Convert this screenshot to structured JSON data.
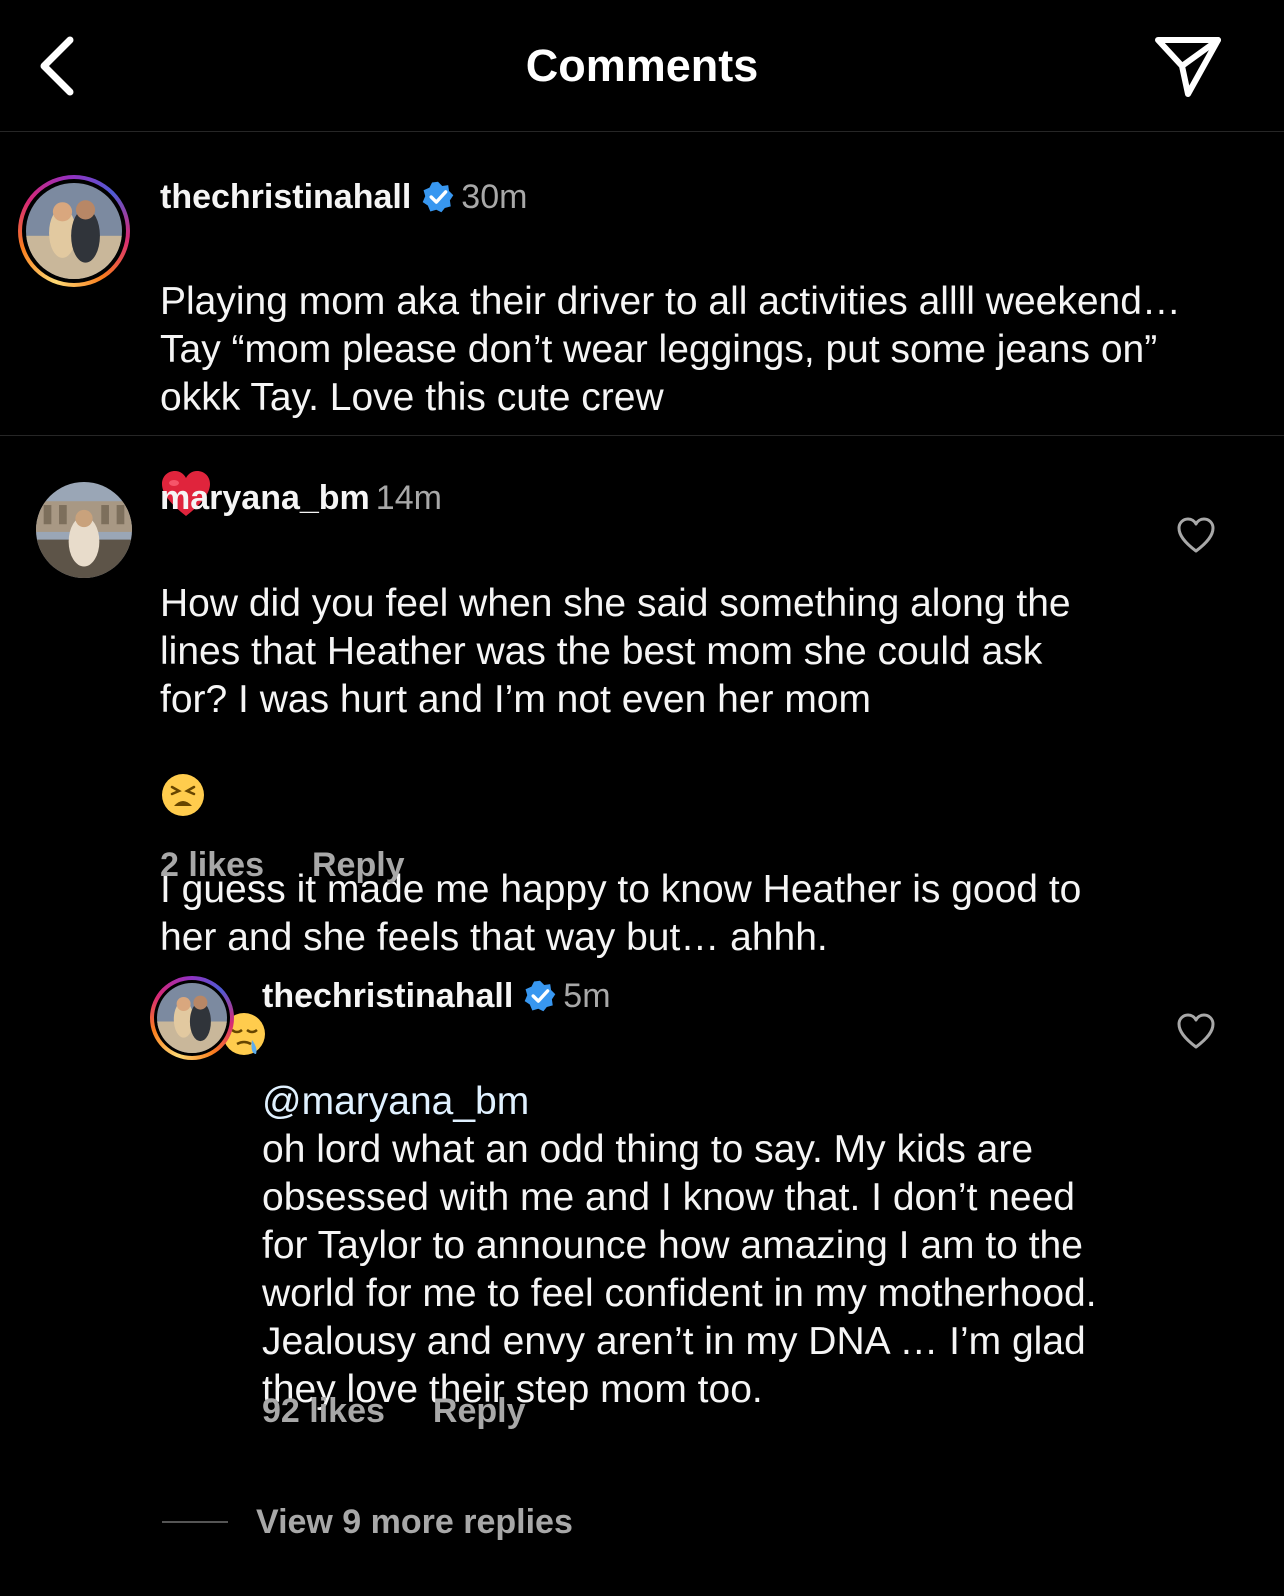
{
  "header": {
    "title": "Comments",
    "back_icon": "chevron-left-icon",
    "share_icon": "paper-plane-icon"
  },
  "caption": {
    "username": "thechristinahall",
    "verified": true,
    "time": "30m",
    "text": "Playing mom aka their driver to all activities allll weekend… Tay “mom please don’t wear leggings, put some jeans on” okkk Tay. Love this cute crew",
    "emoji": "❤️"
  },
  "comments": [
    {
      "username": "maryana_bm",
      "time": "14m",
      "text_part1": "How did you feel when she said something along the lines that Heather was the best mom she could ask for? I was hurt and I’m not even her mom",
      "emoji1": "😫",
      "text_part2": "I guess it made me happy to know Heather is good to her and she feels that way but… ahhh.",
      "emoji2": "😪😪",
      "likes": "2 likes",
      "reply": "Reply"
    }
  ],
  "reply": {
    "username": "thechristinahall",
    "verified": true,
    "time": "5m",
    "mention": "@maryana_bm",
    "text": "oh lord what an odd thing to say. My kids are obsessed with me and I know that. I don’t need for Taylor to announce how amazing I am to the world for me to feel confident in my motherhood. Jealousy and envy aren’t in my DNA … I’m glad they love their step mom too.",
    "likes": "92 likes",
    "reply": "Reply"
  },
  "view_more": "View 9 more replies",
  "colors": {
    "background": "#000000",
    "text": "#f5f5f5",
    "secondary": "#a8a8a8",
    "verified": "#3897f0",
    "mention": "#e0f1ff",
    "divider": "#262626"
  }
}
